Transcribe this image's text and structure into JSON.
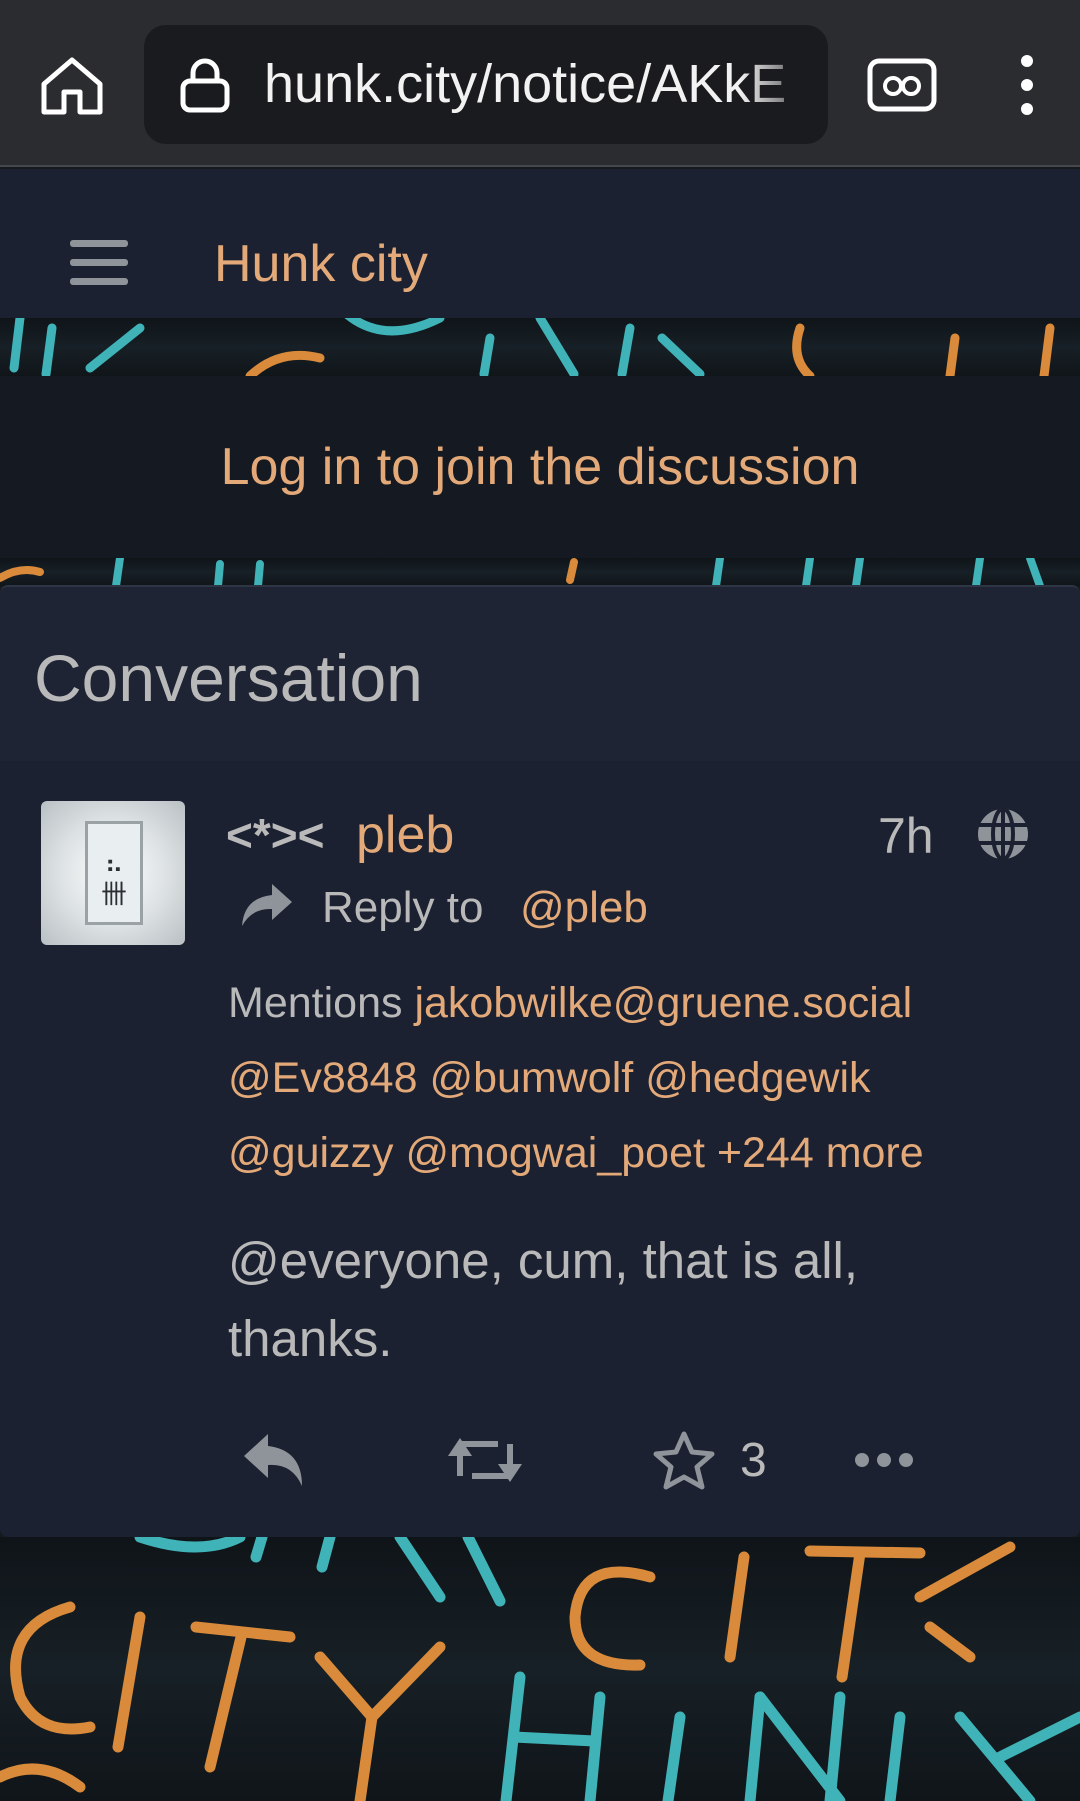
{
  "browser": {
    "url": "hunk.city/notice/AKkE",
    "icons": [
      "home-icon",
      "lock-icon",
      "incognito-tabs-icon",
      "overflow-menu-icon"
    ]
  },
  "site": {
    "title": "Hunk city",
    "login_prompt": "Log in to join the discussion"
  },
  "conversation": {
    "heading": "Conversation",
    "post": {
      "author_prefix": "<*><",
      "author_name": "pleb",
      "time": "7h",
      "visibility_icon": "globe-icon",
      "reply_label": "Reply to",
      "reply_to": "@pleb",
      "mentions_label": "Mentions",
      "mentions": [
        "jakobwilke@gruene.social",
        "@Ev8848",
        "@bumwolf",
        "@hedgewik",
        "@guizzy",
        "@mogwai_poet"
      ],
      "mentions_more": "+244 more",
      "body": "@everyone, cum, that is all, thanks.",
      "favorites": "3"
    }
  },
  "colors": {
    "accent": "#e4a979",
    "text": "#b9b9ba",
    "panel": "#1b2130",
    "neon_teal": "#3fb3b8",
    "neon_orange": "#d98a3a"
  }
}
